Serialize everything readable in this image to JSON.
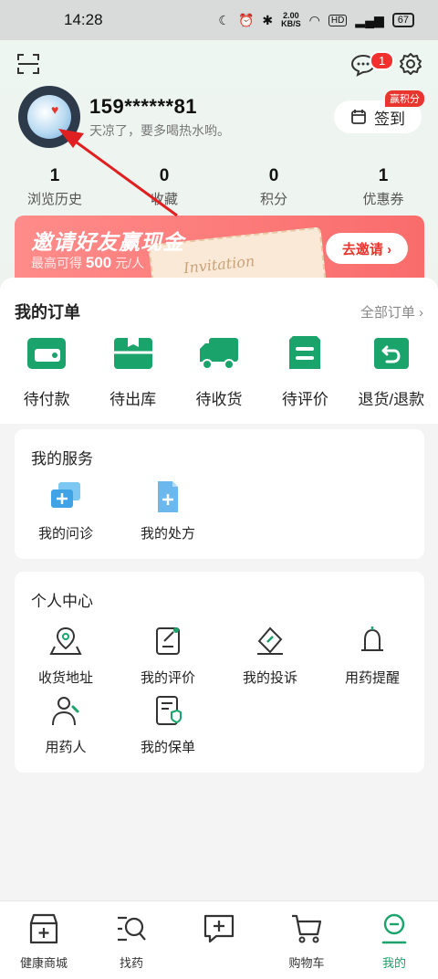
{
  "status_bar": {
    "time": "14:28",
    "net_speed": "2.00",
    "net_unit": "KB/S",
    "battery": "67",
    "hd": "HD"
  },
  "profile": {
    "notification_count": "1",
    "username": "159******81",
    "tagline": "天凉了，要多喝热水哟。",
    "signin_label": "签到",
    "signin_tag": "赢积分"
  },
  "stats": [
    {
      "value": "1",
      "label": "浏览历史"
    },
    {
      "value": "0",
      "label": "收藏"
    },
    {
      "value": "0",
      "label": "积分"
    },
    {
      "value": "1",
      "label": "优惠券"
    }
  ],
  "banner": {
    "title": "邀请好友赢现金",
    "sub_prefix": "最高可得",
    "sub_amount": "500",
    "sub_suffix": "元/人",
    "ticket_text": "Invitation",
    "button": "去邀请 ›"
  },
  "orders": {
    "title": "我的订单",
    "all_label": "全部订单 ›",
    "items": [
      {
        "label": "待付款",
        "icon": "wallet-icon"
      },
      {
        "label": "待出库",
        "icon": "package-icon"
      },
      {
        "label": "待收货",
        "icon": "truck-icon"
      },
      {
        "label": "待评价",
        "icon": "review-icon"
      },
      {
        "label": "退货/退款",
        "icon": "refund-icon"
      }
    ]
  },
  "services": {
    "title": "我的服务",
    "items": [
      {
        "label": "我的问诊",
        "icon": "consult-icon"
      },
      {
        "label": "我的处方",
        "icon": "prescription-icon"
      }
    ]
  },
  "personal": {
    "title": "个人中心",
    "items": [
      {
        "label": "收货地址",
        "icon": "location-icon"
      },
      {
        "label": "我的评价",
        "icon": "edit-icon"
      },
      {
        "label": "我的投诉",
        "icon": "complaint-icon"
      },
      {
        "label": "用药提醒",
        "icon": "bell-icon"
      },
      {
        "label": "用药人",
        "icon": "user-icon"
      },
      {
        "label": "我的保单",
        "icon": "policy-icon"
      }
    ]
  },
  "tabbar": [
    {
      "label": "健康商城",
      "icon": "store-icon"
    },
    {
      "label": "找药",
      "icon": "search-drug-icon"
    },
    {
      "label": "",
      "icon": "chat-plus-icon"
    },
    {
      "label": "购物车",
      "icon": "cart-icon"
    },
    {
      "label": "我的",
      "icon": "profile-icon",
      "active": true
    }
  ],
  "colors": {
    "accent": "#1aa36b",
    "red": "#e8362f"
  }
}
